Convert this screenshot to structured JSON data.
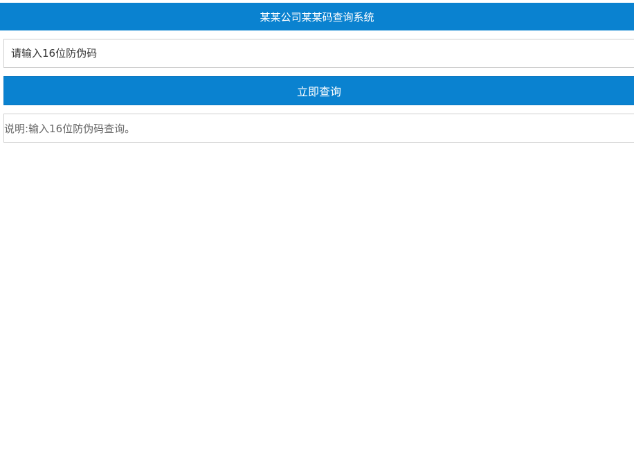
{
  "header": {
    "title": "某某公司某某码查询系统"
  },
  "form": {
    "input_placeholder": "请输入16位防伪码",
    "input_value": "",
    "submit_label": "立即查询"
  },
  "note": {
    "text": "说明:输入16位防伪码查询。"
  },
  "colors": {
    "accent": "#0a82d0",
    "border": "#cfcfcf",
    "note_text": "#666666"
  }
}
